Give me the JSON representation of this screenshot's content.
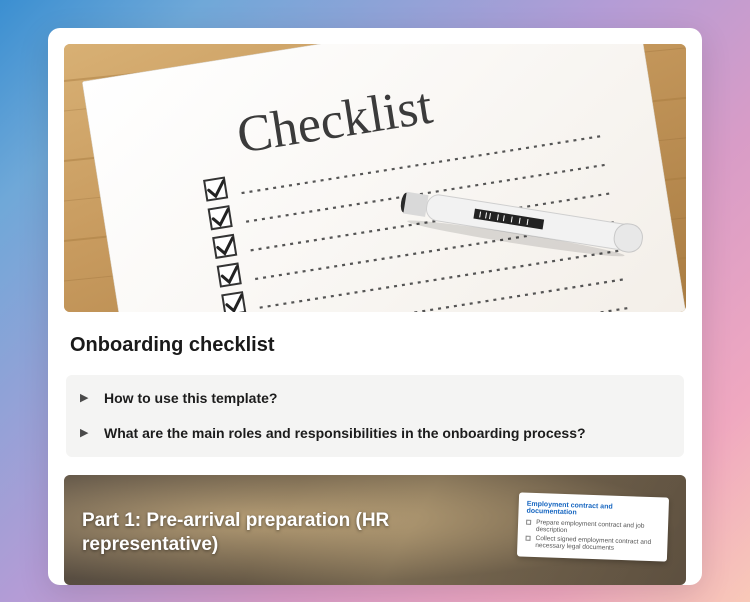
{
  "hero": {
    "word": "Checklist"
  },
  "title": "Onboarding checklist",
  "toggles": [
    {
      "label": "How to use this template?"
    },
    {
      "label": "What are the main roles and responsibilities in the onboarding process?"
    }
  ],
  "part1": {
    "heading": "Part 1: Pre-arrival preparation (HR representative)",
    "subcard": {
      "title": "Employment contract and documentation",
      "lines": [
        "Prepare employment contract and job description",
        "Collect signed employment contract and necessary legal documents"
      ]
    }
  }
}
